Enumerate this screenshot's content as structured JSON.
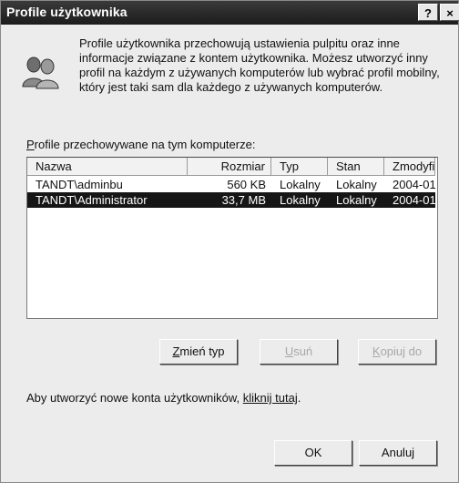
{
  "window": {
    "title": "Profile użytkownika",
    "help_label": "?",
    "close_label": "×"
  },
  "description": "Profile użytkownika przechowują ustawienia pulpitu oraz inne informacje związane z kontem użytkownika. Możesz utworzyć inny profil na każdym z używanych komputerów lub wybrać profil mobilny, który jest taki sam dla każdego z używanych komputerów.",
  "profiles_label": {
    "mnemonic": "P",
    "rest": "rofile przechowywane na tym komputerze:"
  },
  "table": {
    "columns": [
      "Nazwa",
      "Rozmiar",
      "Typ",
      "Stan",
      "Zmodyfi..."
    ],
    "rows": [
      {
        "name": "TANDT\\adminbu",
        "size": "560 KB",
        "type": "Lokalny",
        "state": "Lokalny",
        "modified": "2004-01..."
      },
      {
        "name": "TANDT\\Administrator",
        "size": "33,7 MB",
        "type": "Lokalny",
        "state": "Lokalny",
        "modified": "2004-01..."
      }
    ],
    "selected_row": 1
  },
  "buttons": {
    "change_type": {
      "mnemonic": "Z",
      "rest": "mień typ"
    },
    "delete": {
      "mnemonic": "U",
      "rest": "suń"
    },
    "copy_to": {
      "mnemonic": "K",
      "rest": "opiuj do"
    },
    "ok": "OK",
    "cancel": "Anuluj"
  },
  "create_accounts": {
    "prefix": "Aby utworzyć nowe konta użytkowników, ",
    "link": "kliknij tutaj",
    "suffix": "."
  },
  "icons": {
    "users": "users-icon"
  }
}
